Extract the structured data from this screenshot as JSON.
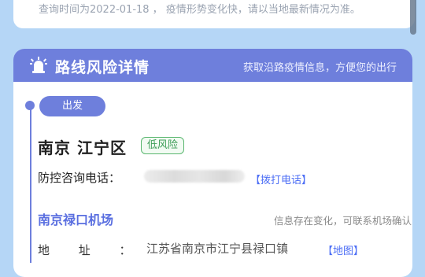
{
  "notice": "查询时间为2022-01-18 ， 疫情形势变化快，请以当地最新情况为准。",
  "header": {
    "title": "路线风险详情",
    "subtitle": "获取沿路疫情信息，方便您的出行",
    "icon": "alarm-light-icon"
  },
  "departure": {
    "label": "出发",
    "location": "南京 江宁区",
    "risk": "低风险",
    "phone_label": "防控咨询电话：",
    "call_link": "【拨打电话】"
  },
  "airport": {
    "name": "南京禄口机场",
    "note": "信息存在变化，可联系机场确认",
    "address_label": "地 址 ：",
    "address_value": "江苏省南京市江宁县禄口镇",
    "map_link": "【地图】"
  },
  "colors": {
    "accent": "#6e7fdc",
    "background": "#b5d6f6",
    "low_risk": "#58b66e",
    "link": "#4c6ef5"
  }
}
